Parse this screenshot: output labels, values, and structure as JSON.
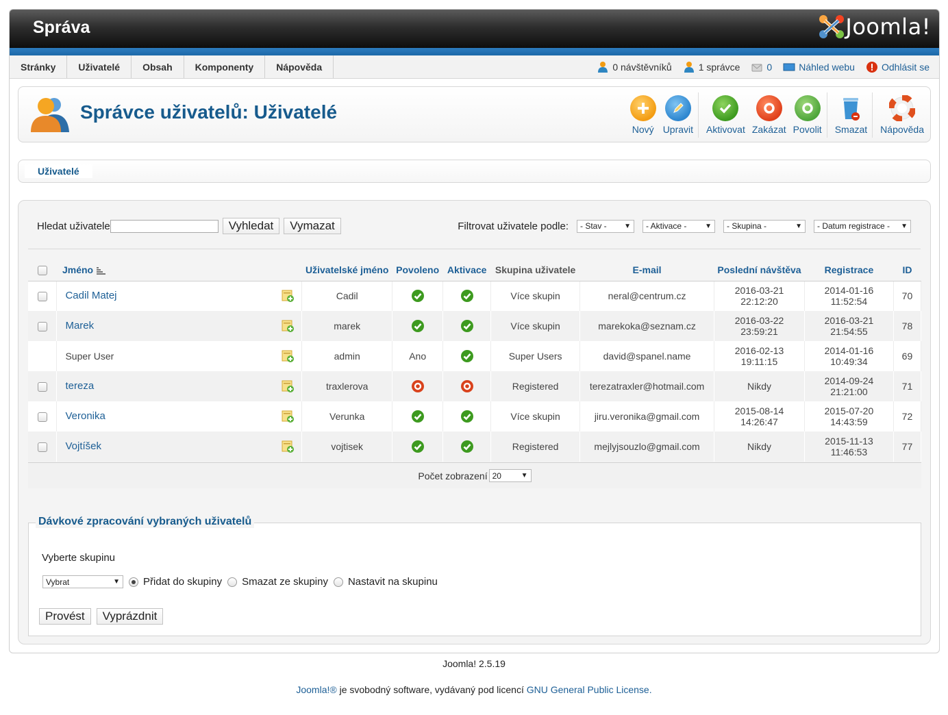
{
  "header": {
    "title": "Správa",
    "logo_text": "Joomla!"
  },
  "menu": [
    "Stránky",
    "Uživatelé",
    "Obsah",
    "Komponenty",
    "Nápověda"
  ],
  "status": {
    "visitors": "0 návštěvníků",
    "admins": "1 správce",
    "messages": "0",
    "preview": "Náhled webu",
    "logout": "Odhlásit se"
  },
  "page": {
    "title": "Správce uživatelů: Uživatelé"
  },
  "toolbar": {
    "new": "Nový",
    "edit": "Upravit",
    "activate": "Aktivovat",
    "block": "Zakázat",
    "unblock": "Povolit",
    "delete": "Smazat",
    "help": "Nápověda"
  },
  "submenu": {
    "tab": "Uživatelé"
  },
  "filter": {
    "search_label": "Hledat uživatele",
    "search_value": "",
    "search_button": "Vyhledat",
    "clear_button": "Vymazat",
    "filter_label": "Filtrovat uživatele podle:",
    "state": "- Stav -",
    "activation": "- Aktivace -",
    "group": "- Skupina -",
    "date": "- Datum registrace -"
  },
  "table": {
    "headers": {
      "name": "Jméno",
      "username": "Uživatelské jméno",
      "enabled": "Povoleno",
      "activated": "Aktivace",
      "group": "Skupina uživatele",
      "email": "E-mail",
      "last_visit": "Poslední návštěva",
      "registered": "Registrace",
      "id": "ID"
    },
    "rows": [
      {
        "name": "Cadil Matej",
        "username": "Cadil",
        "enabled": "ok",
        "activated": "ok",
        "group": "Více skupin",
        "email": "neral@centrum.cz",
        "last_date": "2016-03-21",
        "last_time": "22:12:20",
        "reg_date": "2014-01-16",
        "reg_time": "11:52:54",
        "id": "70"
      },
      {
        "name": "Marek",
        "username": "marek",
        "enabled": "ok",
        "activated": "ok",
        "group": "Více skupin",
        "email": "marekoka@seznam.cz",
        "last_date": "2016-03-22",
        "last_time": "23:59:21",
        "reg_date": "2016-03-21",
        "reg_time": "21:54:55",
        "id": "78"
      },
      {
        "name": "Super User",
        "username": "admin",
        "enabled_text": "Ano",
        "activated": "ok",
        "group": "Super Users",
        "email": "david@spanel.name",
        "last_date": "2016-02-13",
        "last_time": "19:11:15",
        "reg_date": "2014-01-16",
        "reg_time": "10:49:34",
        "id": "69"
      },
      {
        "name": "tereza",
        "username": "traxlerova",
        "enabled": "no",
        "activated": "no",
        "group": "Registered",
        "email": "terezatraxler@hotmail.com",
        "last_date": "Nikdy",
        "last_time": "",
        "reg_date": "2014-09-24",
        "reg_time": "21:21:00",
        "id": "71"
      },
      {
        "name": "Veronika",
        "username": "Verunka",
        "enabled": "ok",
        "activated": "ok",
        "group": "Více skupin",
        "email": "jiru.veronika@gmail.com",
        "last_date": "2015-08-14",
        "last_time": "14:26:47",
        "reg_date": "2015-07-20",
        "reg_time": "14:43:59",
        "id": "72"
      },
      {
        "name": "Vojtíšek",
        "username": "vojtisek",
        "enabled": "ok",
        "activated": "ok",
        "group": "Registered",
        "email": "mejlyjsouzlo@gmail.com",
        "last_date": "Nikdy",
        "last_time": "",
        "reg_date": "2015-11-13",
        "reg_time": "11:46:53",
        "id": "77"
      }
    ]
  },
  "pagination": {
    "label": "Počet zobrazení",
    "value": "20"
  },
  "batch": {
    "legend": "Dávkové zpracování vybraných uživatelů",
    "select_label": "Vyberte skupinu",
    "select_value": "Vybrat",
    "add": "Přidat do skupiny",
    "remove": "Smazat ze skupiny",
    "set": "Nastavit na skupinu",
    "process": "Provést",
    "reset": "Vyprázdnit"
  },
  "footer": {
    "version": "Joomla! 2.5.19",
    "license_link1": "Joomla!®",
    "license_text": " je svobodný software, vydávaný pod licencí ",
    "license_link2": "GNU General Public License."
  },
  "colors": {
    "accent": "#175b8d",
    "link": "#1d5f96",
    "ok": "#3d9a1f",
    "no": "#d9421c"
  }
}
